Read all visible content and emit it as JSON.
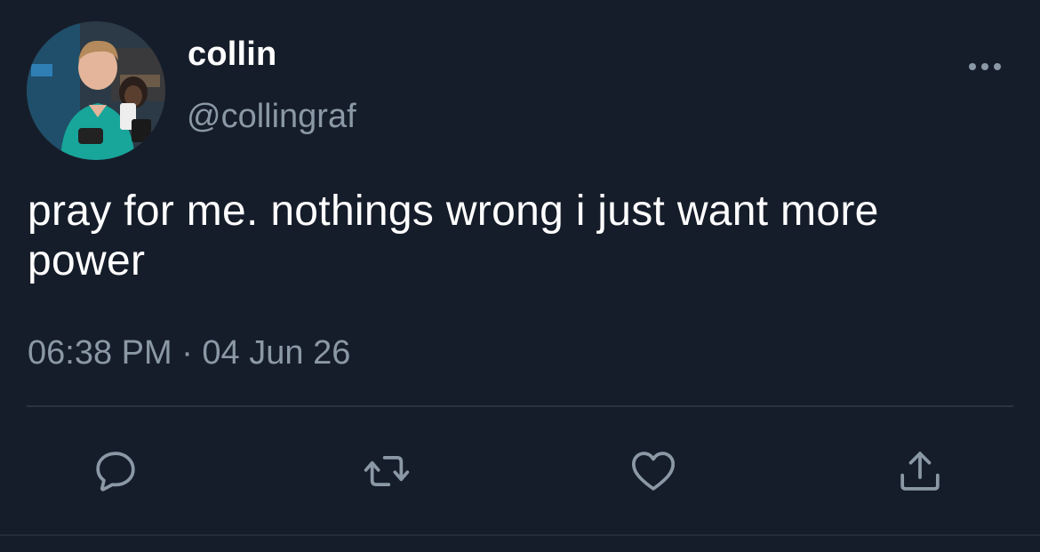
{
  "tweet": {
    "display_name": "collin",
    "handle": "@collingraf",
    "text": "pray for me. nothings wrong i just want more power",
    "timestamp": "06:38 PM · 04 Jun 26"
  },
  "icons": {
    "more": "more-horizontal-icon",
    "reply": "reply-icon",
    "retweet": "retweet-icon",
    "like": "heart-icon",
    "share": "share-icon"
  },
  "colors": {
    "background": "#161d2a",
    "text": "#ffffff",
    "secondary_text": "#8b98a5",
    "divider": "#2a3441"
  }
}
